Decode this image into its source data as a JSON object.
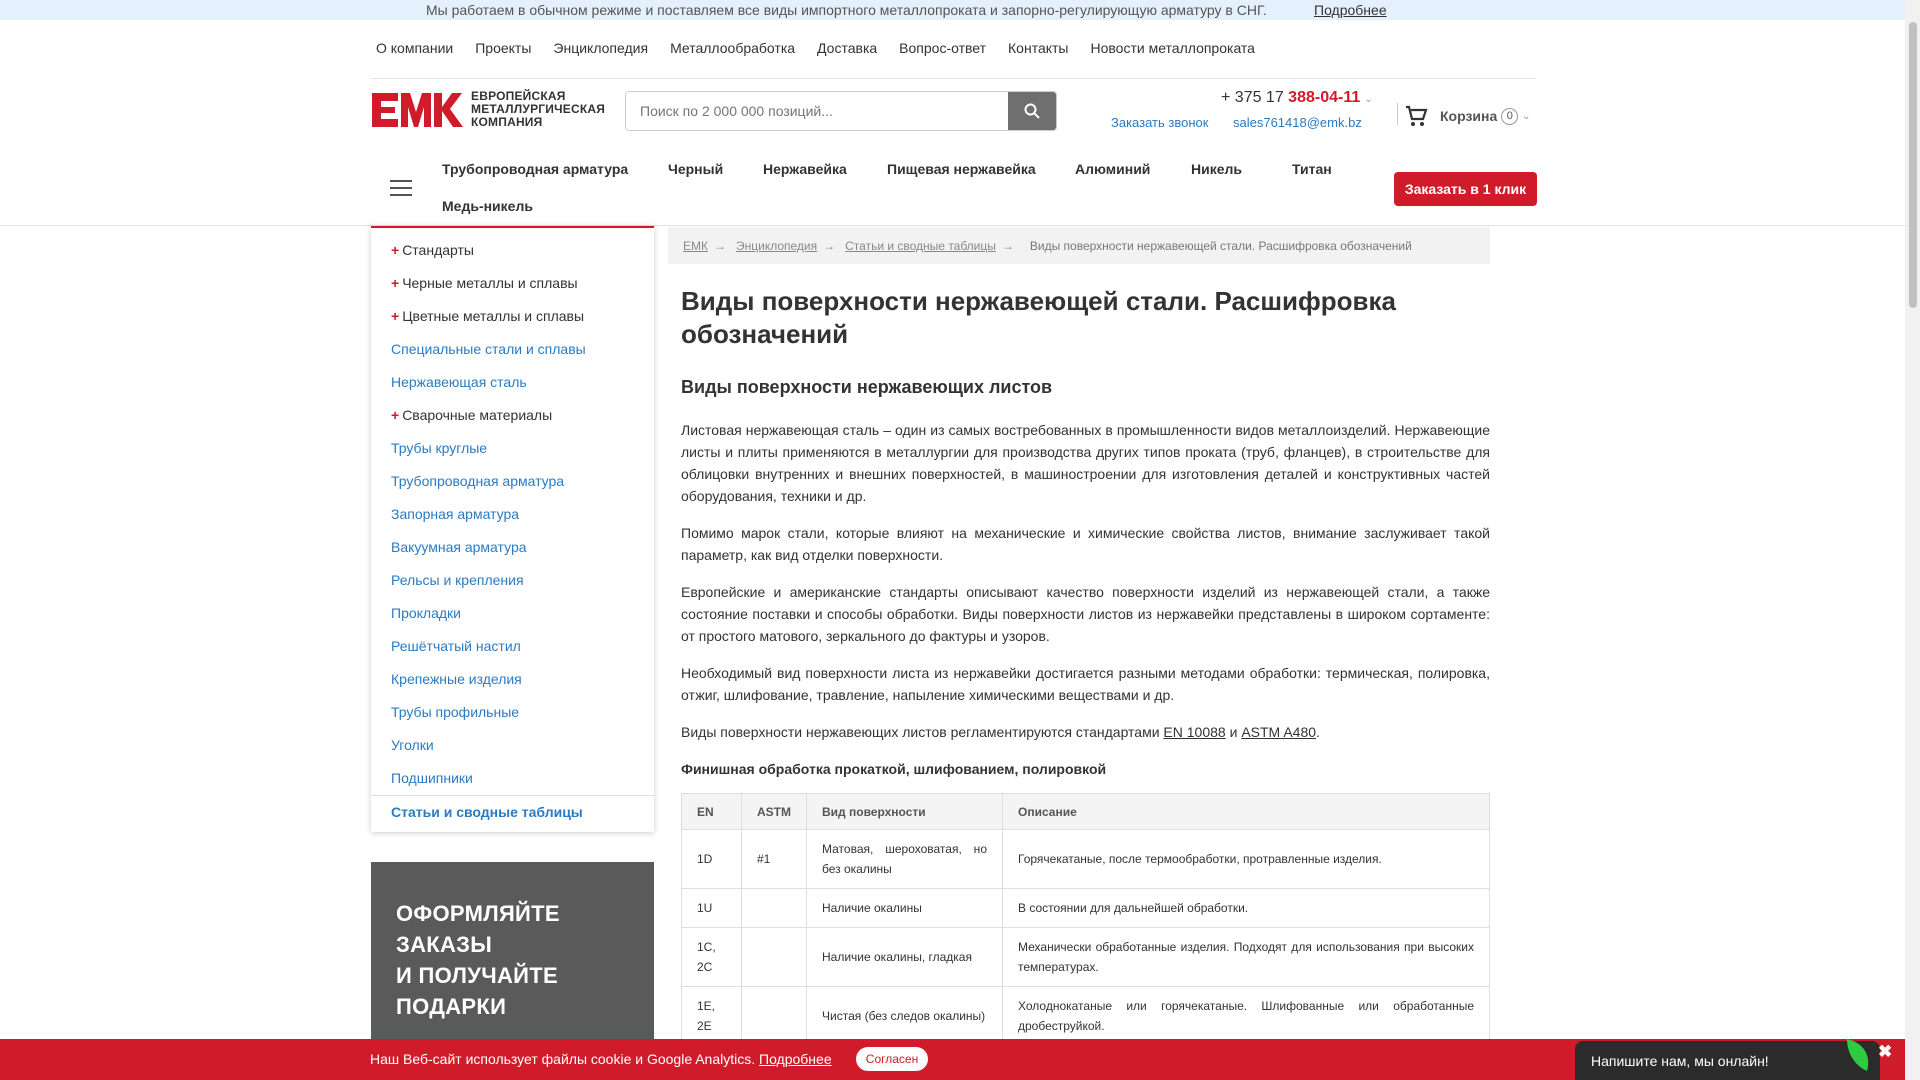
{
  "topbar": {
    "message": "Мы работаем в обычном режиме и поставляем все виды импортного металлопроката и запорно-регулирующую арматуру в СНГ.",
    "more_link": "Подробнее"
  },
  "topnav": [
    "О компании",
    "Проекты",
    "Энциклопедия",
    "Металлообработка",
    "Доставка",
    "Вопрос-ответ",
    "Контакты",
    "Новости металлопроката"
  ],
  "logo": {
    "line1": "ЕВРОПЕЙСКАЯ",
    "line2": "МЕТАЛЛУРГИЧЕСКАЯ",
    "line3": "КОМПАНИЯ",
    "brand_color": "#d01c2a"
  },
  "search": {
    "placeholder": "Поиск по 2 000 000 позиций...",
    "icon": "search-icon"
  },
  "contacts": {
    "phone_prefix": "+ 375 17 ",
    "phone_number": "388-04-11",
    "callback": "Заказать звонок",
    "email": "sales761418@emk.bz"
  },
  "cart": {
    "label": "Корзина",
    "count": "0",
    "icon": "cart-icon"
  },
  "catnav": {
    "items": [
      "Трубопроводная арматура",
      "Черный",
      "Нержавейка",
      "Пищевая нержавейка",
      "Алюминий",
      "Никель",
      "Титан",
      "Медь-никель"
    ],
    "order_button": "Заказать в 1 клик"
  },
  "sidebar": {
    "items": [
      {
        "label": "Стандарты",
        "expandable": true
      },
      {
        "label": "Черные металлы и сплавы",
        "expandable": true
      },
      {
        "label": "Цветные металлы и сплавы",
        "expandable": true
      },
      {
        "label": "Специальные стали и сплавы",
        "expandable": false
      },
      {
        "label": "Нержавеющая сталь",
        "expandable": false
      },
      {
        "label": "Сварочные материалы",
        "expandable": true
      },
      {
        "label": "Трубы круглые",
        "expandable": false
      },
      {
        "label": "Трубопроводная арматура",
        "expandable": false
      },
      {
        "label": "Запорная арматура",
        "expandable": false
      },
      {
        "label": "Вакуумная арматура",
        "expandable": false
      },
      {
        "label": "Рельсы и крепления",
        "expandable": false
      },
      {
        "label": "Прокладки",
        "expandable": false
      },
      {
        "label": "Решётчатый настил",
        "expandable": false
      },
      {
        "label": "Крепежные изделия",
        "expandable": false
      },
      {
        "label": "Трубы профильные",
        "expandable": false
      },
      {
        "label": "Уголки",
        "expandable": false
      },
      {
        "label": "Подшипники",
        "expandable": false
      },
      {
        "label": "Статьи и сводные таблицы",
        "expandable": false,
        "active": true
      }
    ]
  },
  "promo": {
    "lines": [
      "ОФОРМЛЯЙТЕ",
      "ЗАКАЗЫ",
      "И ПОЛУЧАЙТЕ",
      "ПОДАРКИ"
    ]
  },
  "breadcrumb": {
    "items": [
      "ЕМК",
      "Энциклопедия",
      "Статьи и сводные таблицы"
    ],
    "current": "Виды поверхности нержавеющей стали. Расшифровка обозначений"
  },
  "article": {
    "title": "Виды поверхности нержавеющей стали. Расшифровка обозначений",
    "subtitle": "Виды поверхности нержавеющих листов",
    "p1": "Листовая нержавеющая сталь – один из самых востребованных в промышленности видов металлоизделий. Нержавеющие листы и плиты применяются в металлургии для производства других типов проката (труб, фланцев), в строительстве для облицовки внутренних и внешних поверхностей, в машиностроении для изготовления деталей и конструктивных частей оборудования, техники и др.",
    "p2": "Помимо марок стали, которые влияют на механические и химические свойства листов, внимание заслуживает такой параметр, как вид отделки поверхности.",
    "p3": "Европейские и американские стандарты описывают качество поверхности изделий из нержавеющей стали, а также состояние поставки и способы обработки. Виды поверхности листов из нержавейки представлены в широком сортаменте: от простого матового, зеркального до фактуры и узоров.",
    "p4": "Необходимый вид поверхности листа из нержавейки достигается разными методами обработки: термическая, полировка, отжиг, шлифование, травление, напыление химическими веществами и др.",
    "p5_before": "Виды поверхности нержавеющих листов регламентируются стандартами ",
    "p5_link1": "EN 10088",
    "p5_mid": " и ",
    "p5_link2": "ASTM A480",
    "p5_after": ".",
    "table_caption": "Финишная обработка прокаткой, шлифованием, полировкой",
    "table_headers": [
      "EN",
      "ASTM",
      "Вид поверхности",
      "Описание"
    ],
    "table_rows": [
      [
        "1D",
        "#1",
        "Матовая, шероховатая, но без окалины",
        "Горячекатаные, после термообработки, протравленные изделия."
      ],
      [
        "1U",
        "",
        "Наличие окалины",
        "В состоянии для дальнейшей обработки."
      ],
      [
        "1C, 2C",
        "",
        "Наличие окалины, гладкая",
        "Механически обработанные изделия. Подходят для использования при высоких температурах."
      ],
      [
        "1E, 2E",
        "",
        "Чистая (без следов окалины)",
        "Холоднокатаные или горячекатаные. Шлифованные или обработанные дробеструйкой."
      ]
    ]
  },
  "cookie": {
    "text": "Наш Веб-сайт использует файлы cookie и Google Analytics.",
    "more": "Подробнее",
    "accept": "Согласен"
  },
  "chat": {
    "text": "Напишите нам, мы онлайн!",
    "close": "✖"
  }
}
